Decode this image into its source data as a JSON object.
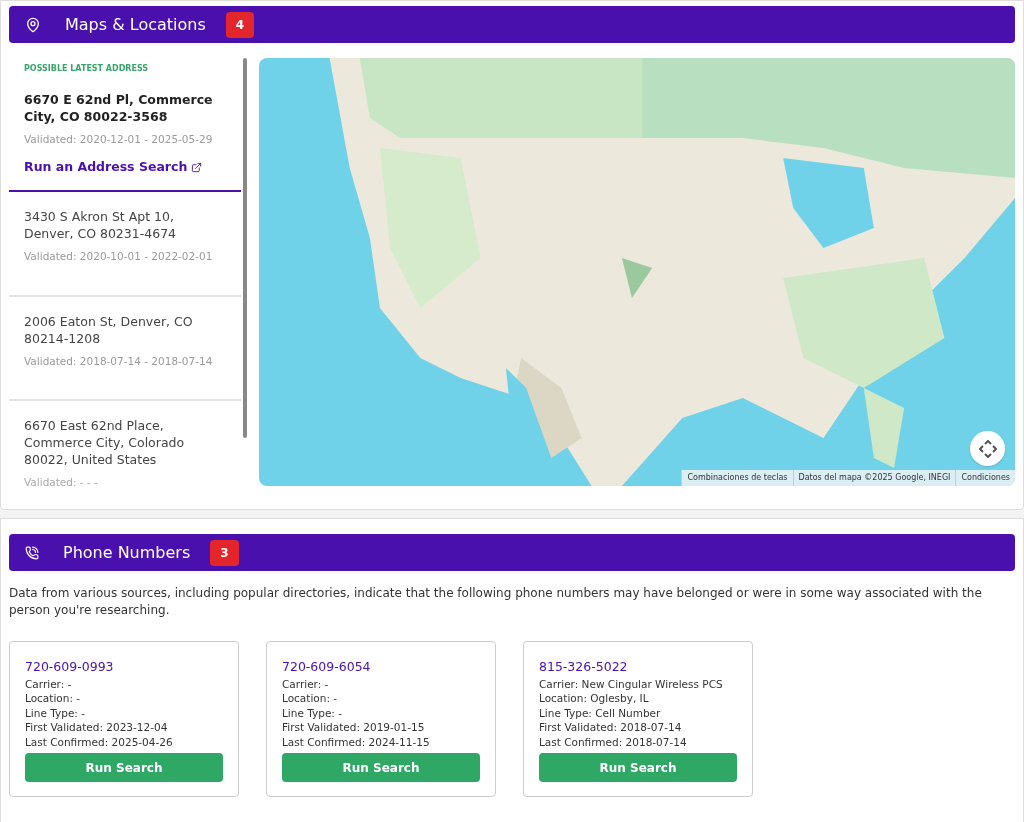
{
  "maps_section": {
    "title": "Maps & Locations",
    "count": "4",
    "latest_label": "POSSIBLE LATEST ADDRESS",
    "addresses": [
      {
        "address": "6670 E 62nd Pl, Commerce City, CO 80022-3568",
        "validated": "Validated: 2020-12-01 - 2025-05-29",
        "link": "Run an Address Search",
        "selected": true
      },
      {
        "address": "3430 S Akron St Apt 10, Denver, CO 80231-4674",
        "validated": "Validated: 2020-10-01 - 2022-02-01",
        "selected": false
      },
      {
        "address": "2006 Eaton St, Denver, CO 80214-1208",
        "validated": "Validated: 2018-07-14 - 2018-07-14",
        "selected": false
      },
      {
        "address": "6670 East 62nd Place, Commerce City, Colorado 80022, United States",
        "validated": "Validated: - - -",
        "selected": false
      }
    ],
    "map": {
      "kind": "picture",
      "attribution": [
        "Combinaciones de teclas",
        "Datos del mapa ©2025 Google, INEGI",
        "Condiciones"
      ]
    }
  },
  "phone_section": {
    "title": "Phone Numbers",
    "count": "3",
    "intro": "Data from various sources, including popular directories, indicate that the following phone numbers may have belonged or were in some way associated with the person you're researching.",
    "phones": [
      {
        "number": "720-609-0993",
        "details": [
          "Carrier: -",
          "Location: -",
          "Line Type: -",
          "First Validated: 2023-12-04",
          "Last Confirmed: 2025-04-26"
        ],
        "button": "Run Search"
      },
      {
        "number": "720-609-6054",
        "details": [
          "Carrier: -",
          "Location: -",
          "Line Type: -",
          "First Validated: 2019-01-15",
          "Last Confirmed: 2024-11-15"
        ],
        "button": "Run Search"
      },
      {
        "number": "815-326-5022",
        "details": [
          "Carrier: New Cingular Wireless PCS",
          "Location: Oglesby, IL",
          "Line Type: Cell Number",
          "First Validated: 2018-07-14",
          "Last Confirmed: 2018-07-14"
        ],
        "button": "Run Search"
      }
    ]
  }
}
